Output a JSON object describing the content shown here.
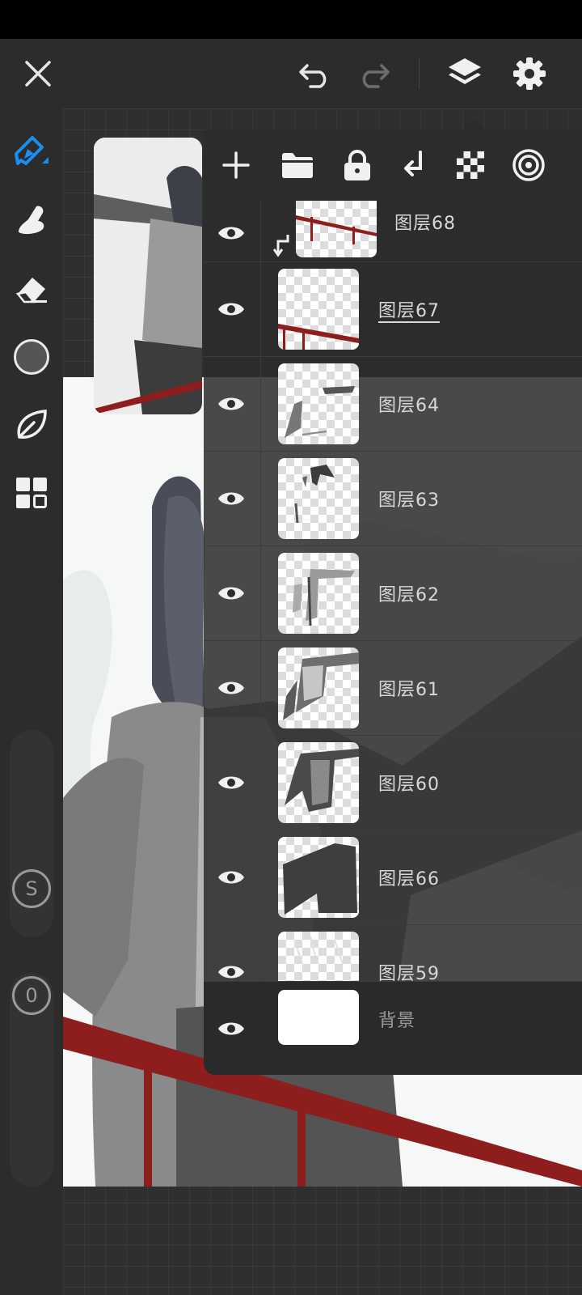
{
  "app": {
    "accent": "#1a8ff0",
    "icon_color": "#e6e6e6"
  },
  "topbar": {
    "icons": [
      "close-icon",
      "undo-icon",
      "redo-icon",
      "layers-icon",
      "settings-icon"
    ]
  },
  "toolbar": {
    "tools": [
      "brush-icon",
      "smudge-icon",
      "eraser-icon",
      "color-swatch",
      "leaf-icon",
      "grid-icon"
    ],
    "current_color": "#555555",
    "size_label": "S",
    "opacity_label": "0"
  },
  "layers_panel": {
    "actions": [
      "add-layer-icon",
      "folder-icon",
      "lock-icon",
      "clip-icon",
      "transparency-icon",
      "blend-icon"
    ],
    "layers": [
      {
        "name": "图层68",
        "visible": true,
        "clipped": true,
        "active": false
      },
      {
        "name": "图层67",
        "visible": true,
        "clipped": false,
        "active": true
      },
      {
        "name": "图层64",
        "visible": true,
        "clipped": false,
        "active": false
      },
      {
        "name": "图层63",
        "visible": true,
        "clipped": false,
        "active": false
      },
      {
        "name": "图层62",
        "visible": true,
        "clipped": false,
        "active": false
      },
      {
        "name": "图层61",
        "visible": true,
        "clipped": false,
        "active": false
      },
      {
        "name": "图层60",
        "visible": true,
        "clipped": false,
        "active": false
      },
      {
        "name": "图层66",
        "visible": true,
        "clipped": false,
        "active": false
      },
      {
        "name": "图层59",
        "visible": true,
        "clipped": false,
        "active": false
      }
    ],
    "background": {
      "name": "背景",
      "visible": true
    }
  }
}
